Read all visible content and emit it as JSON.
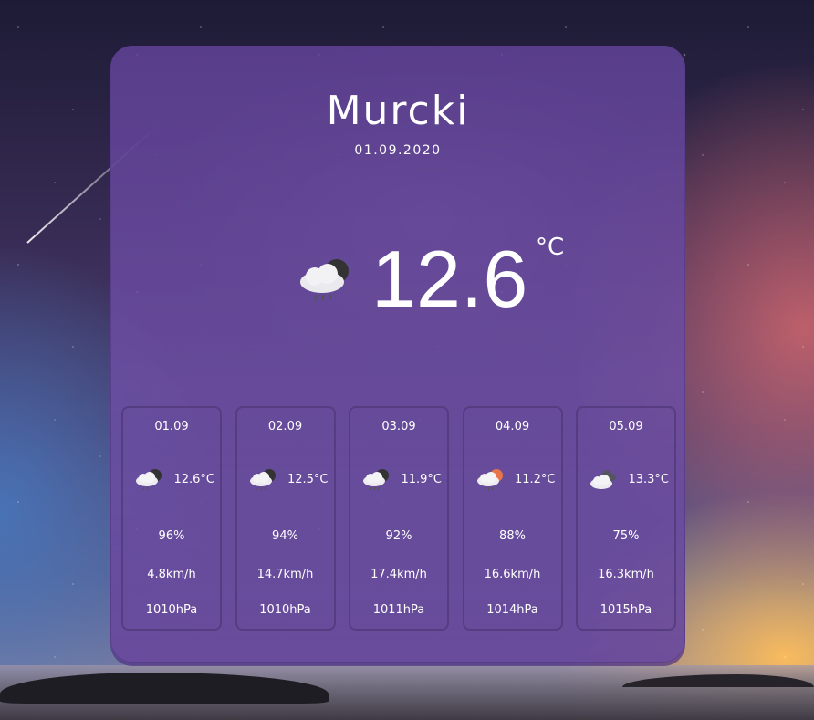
{
  "city": "Murcki",
  "date": "01.09.2020",
  "current": {
    "temp": "12.6",
    "unit": "°C",
    "icon": "cloud-rain-night-icon"
  },
  "forecast": [
    {
      "date": "01.09",
      "temp": "12.6°C",
      "humidity": "96%",
      "wind": "4.8km/h",
      "pressure": "1010hPa",
      "icon": "cloud-rain-night-icon"
    },
    {
      "date": "02.09",
      "temp": "12.5°C",
      "humidity": "94%",
      "wind": "14.7km/h",
      "pressure": "1010hPa",
      "icon": "cloud-rain-night-icon"
    },
    {
      "date": "03.09",
      "temp": "11.9°C",
      "humidity": "92%",
      "wind": "17.4km/h",
      "pressure": "1011hPa",
      "icon": "cloud-rain-night-icon"
    },
    {
      "date": "04.09",
      "temp": "11.2°C",
      "humidity": "88%",
      "wind": "16.6km/h",
      "pressure": "1014hPa",
      "icon": "cloud-rain-sun-icon"
    },
    {
      "date": "05.09",
      "temp": "13.3°C",
      "humidity": "75%",
      "wind": "16.3km/h",
      "pressure": "1015hPa",
      "icon": "clouds-icon"
    }
  ],
  "colors": {
    "card": "#6a4a9e",
    "text": "#ffffff",
    "sun": "#e8744a",
    "moon": "#3a3a3a"
  }
}
